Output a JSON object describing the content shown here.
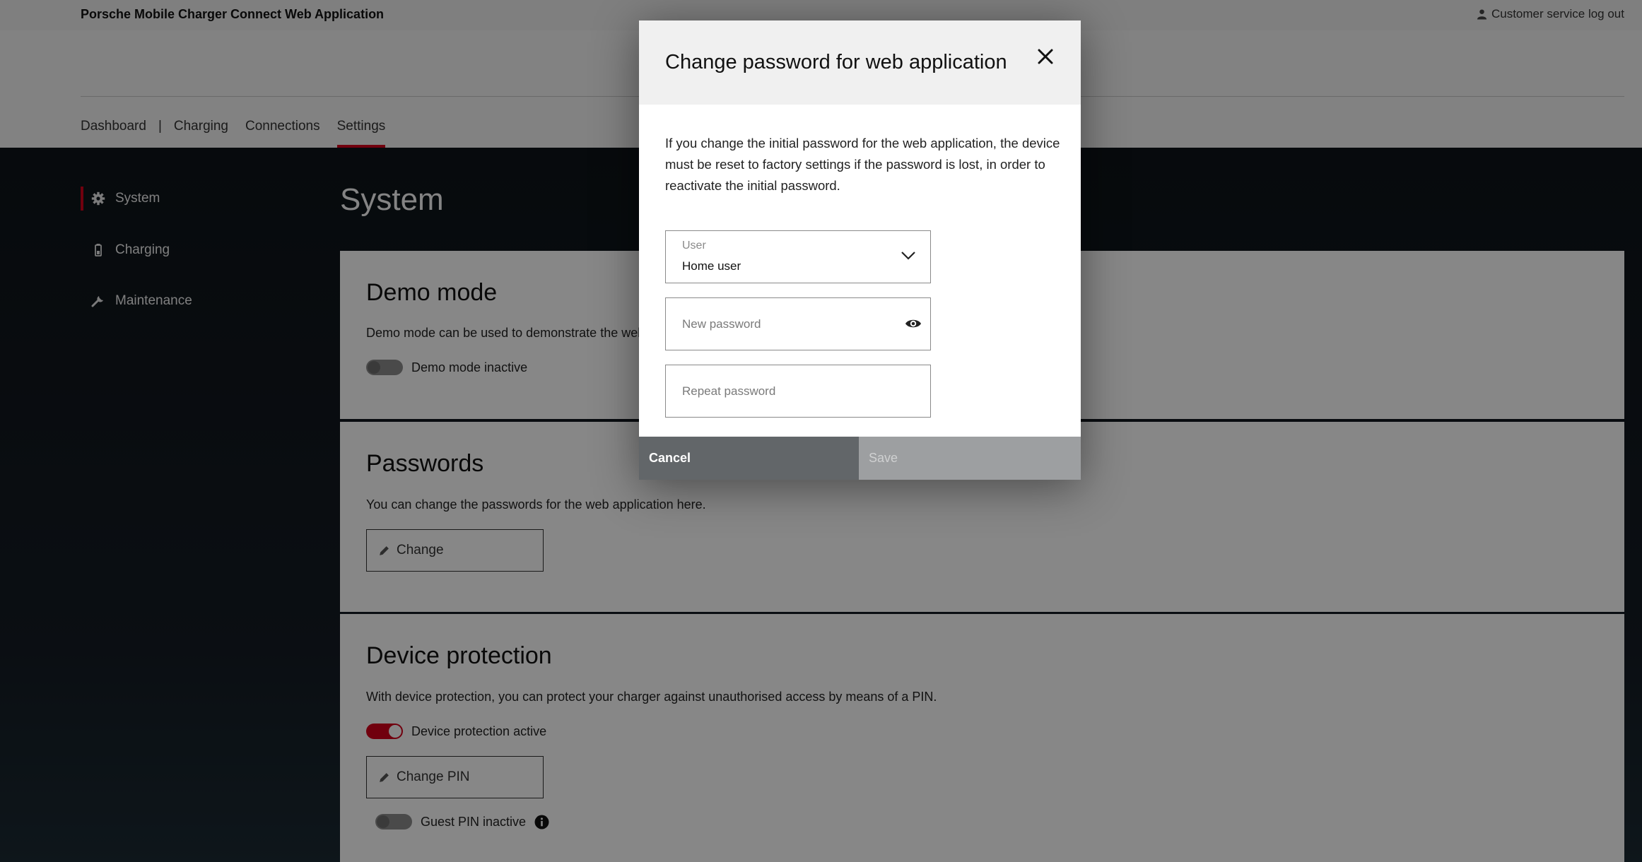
{
  "header": {
    "app_title": "Porsche Mobile Charger Connect Web Application",
    "logout_label": "Customer service log out"
  },
  "nav": {
    "tabs": [
      {
        "label": "Dashboard"
      },
      {
        "label": "Charging"
      },
      {
        "label": "Connections"
      },
      {
        "label": "Settings",
        "active": true
      }
    ],
    "separator": "|"
  },
  "sidebar": {
    "items": [
      {
        "label": "System",
        "icon": "gear-icon",
        "active": true
      },
      {
        "label": "Charging",
        "icon": "battery-icon"
      },
      {
        "label": "Maintenance",
        "icon": "wrench-icon"
      }
    ]
  },
  "main": {
    "title": "System",
    "demo_mode": {
      "heading": "Demo mode",
      "description": "Demo mode can be used to demonstrate the web",
      "toggle_label": "Demo mode inactive",
      "active": false
    },
    "passwords": {
      "heading": "Passwords",
      "description": "You can change the passwords for the web application here.",
      "button_label": "Change"
    },
    "device_protection": {
      "heading": "Device protection",
      "description": "With device protection, you can protect your charger against unauthorised access by means of a PIN.",
      "toggle_label": "Device protection active",
      "active": true,
      "button_label": "Change PIN",
      "guest_pin_label": "Guest PIN inactive",
      "guest_pin_active": false
    }
  },
  "modal": {
    "title": "Change password for web application",
    "description": "If you change the initial password for the web application, the device must be reset to factory settings if the password is lost, in order to reactivate the initial password.",
    "user_field": {
      "label": "User",
      "value": "Home user"
    },
    "new_password": {
      "placeholder": "New password"
    },
    "repeat_password": {
      "placeholder": "Repeat password"
    },
    "cancel_label": "Cancel",
    "save_label": "Save"
  },
  "colors": {
    "accent": "#d5001c",
    "dark_background": "#0e141b",
    "cancel_button": "#626669",
    "save_button_disabled": "#9d9fa1"
  }
}
